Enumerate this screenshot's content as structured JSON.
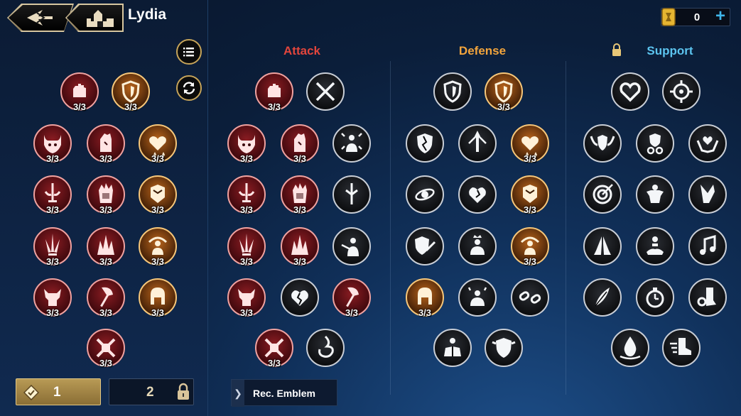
{
  "header": {
    "title": "Lydia",
    "currency": {
      "value": "0"
    }
  },
  "columns": {
    "attack": "Attack",
    "defense": "Defense",
    "support": "Support"
  },
  "colors": {
    "attack": "#e2453c",
    "defense": "#f2a43c",
    "support": "#5cc4ef"
  },
  "levels": {
    "level1": "1",
    "level2": "2"
  },
  "rec_button": {
    "label": "Rec. Emblem"
  },
  "loadout_emblems": [
    {
      "icon": "fist-icon",
      "type": "attack",
      "count": "3/3"
    },
    {
      "icon": "shield-icon",
      "type": "defense",
      "count": "3/3"
    },
    {
      "icon": "demon-horns-icon",
      "type": "attack",
      "count": "3/3"
    },
    {
      "icon": "gauntlet-icon",
      "type": "attack",
      "count": "3/3"
    },
    {
      "icon": "heart-sparkle-icon",
      "type": "defense",
      "count": "3/3"
    },
    {
      "icon": "sword-wings-icon",
      "type": "attack",
      "count": "3/3"
    },
    {
      "icon": "burning-fist-icon",
      "type": "attack",
      "count": "3/3"
    },
    {
      "icon": "armor-icon",
      "type": "defense",
      "count": "3/3"
    },
    {
      "icon": "triple-blade-icon",
      "type": "attack",
      "count": "3/3"
    },
    {
      "icon": "spikes-icon",
      "type": "attack",
      "count": "3/3"
    },
    {
      "icon": "figure-arc-icon",
      "type": "defense",
      "count": "3/3"
    },
    {
      "icon": "horned-warrior-icon",
      "type": "attack",
      "count": "3/3"
    },
    {
      "icon": "axe-icon",
      "type": "attack",
      "count": "3/3"
    },
    {
      "icon": "helmet-icon",
      "type": "defense",
      "count": "3/3"
    },
    {
      "icon": "crossed-fist-icon",
      "type": "attack",
      "count": "3/3"
    }
  ],
  "attack_emblems": [
    {
      "icon": "fist-icon",
      "type": "attack",
      "count": "3/3"
    },
    {
      "icon": "crossed-swords-icon",
      "type": "none",
      "count": ""
    },
    {
      "icon": "demon-horns-icon",
      "type": "attack",
      "count": "3/3"
    },
    {
      "icon": "gauntlet-icon",
      "type": "attack",
      "count": "3/3"
    },
    {
      "icon": "figure-arrows-icon",
      "type": "none",
      "count": ""
    },
    {
      "icon": "sword-wings-icon",
      "type": "attack",
      "count": "3/3"
    },
    {
      "icon": "burning-fist-icon",
      "type": "attack",
      "count": "3/3"
    },
    {
      "icon": "sword-burst-icon",
      "type": "none",
      "count": ""
    },
    {
      "icon": "triple-blade-icon",
      "type": "attack",
      "count": "3/3"
    },
    {
      "icon": "spikes-icon",
      "type": "attack",
      "count": "3/3"
    },
    {
      "icon": "pierced-figure-icon",
      "type": "none",
      "count": ""
    },
    {
      "icon": "horned-warrior-icon",
      "type": "attack",
      "count": "3/3"
    },
    {
      "icon": "broken-heart-icon",
      "type": "none",
      "count": ""
    },
    {
      "icon": "axe-icon",
      "type": "attack",
      "count": "3/3"
    },
    {
      "icon": "crossed-fist-icon",
      "type": "attack",
      "count": "3/3"
    },
    {
      "icon": "swirl-flame-icon",
      "type": "none",
      "count": ""
    }
  ],
  "defense_emblems": [
    {
      "icon": "shield-icon",
      "type": "none",
      "count": ""
    },
    {
      "icon": "shield-icon",
      "type": "defense",
      "count": "3/3"
    },
    {
      "icon": "cracked-shield-icon",
      "type": "none",
      "count": ""
    },
    {
      "icon": "sword-up-icon",
      "type": "none",
      "count": ""
    },
    {
      "icon": "heart-sparkle-icon",
      "type": "defense",
      "count": "3/3"
    },
    {
      "icon": "orbit-icon",
      "type": "none",
      "count": ""
    },
    {
      "icon": "heart-crack-icon",
      "type": "none",
      "count": ""
    },
    {
      "icon": "armor-icon",
      "type": "defense",
      "count": "3/3"
    },
    {
      "icon": "shield-wand-icon",
      "type": "none",
      "count": ""
    },
    {
      "icon": "crowned-figure-icon",
      "type": "none",
      "count": ""
    },
    {
      "icon": "figure-arc-icon",
      "type": "defense",
      "count": "3/3"
    },
    {
      "icon": "helmet-icon",
      "type": "defense",
      "count": "3/3"
    },
    {
      "icon": "sparkle-figure-icon",
      "type": "none",
      "count": ""
    },
    {
      "icon": "broken-chain-icon",
      "type": "none",
      "count": ""
    },
    {
      "icon": "suit-icon",
      "type": "none",
      "count": ""
    },
    {
      "icon": "shield-spikes-icon",
      "type": "none",
      "count": ""
    }
  ],
  "support_emblems": [
    {
      "icon": "heart-frame-icon",
      "type": "none",
      "count": ""
    },
    {
      "icon": "crosshair-icon",
      "type": "none",
      "count": ""
    },
    {
      "icon": "winged-shield-icon",
      "type": "none",
      "count": ""
    },
    {
      "icon": "chain-shield-icon",
      "type": "none",
      "count": ""
    },
    {
      "icon": "hands-heart-icon",
      "type": "none",
      "count": ""
    },
    {
      "icon": "target-icon",
      "type": "none",
      "count": ""
    },
    {
      "icon": "buff-figure-icon",
      "type": "none",
      "count": ""
    },
    {
      "icon": "boot-dash-icon",
      "type": "none",
      "count": ""
    },
    {
      "icon": "praying-hands-icon",
      "type": "none",
      "count": ""
    },
    {
      "icon": "meditate-icon",
      "type": "none",
      "count": ""
    },
    {
      "icon": "music-note-icon",
      "type": "none",
      "count": ""
    },
    {
      "icon": "feather-hand-icon",
      "type": "none",
      "count": ""
    },
    {
      "icon": "stopwatch-icon",
      "type": "none",
      "count": ""
    },
    {
      "icon": "gear-boot-icon",
      "type": "none",
      "count": ""
    },
    {
      "icon": "droplet-icon",
      "type": "none",
      "count": ""
    },
    {
      "icon": "speed-boot-icon",
      "type": "none",
      "count": ""
    }
  ]
}
